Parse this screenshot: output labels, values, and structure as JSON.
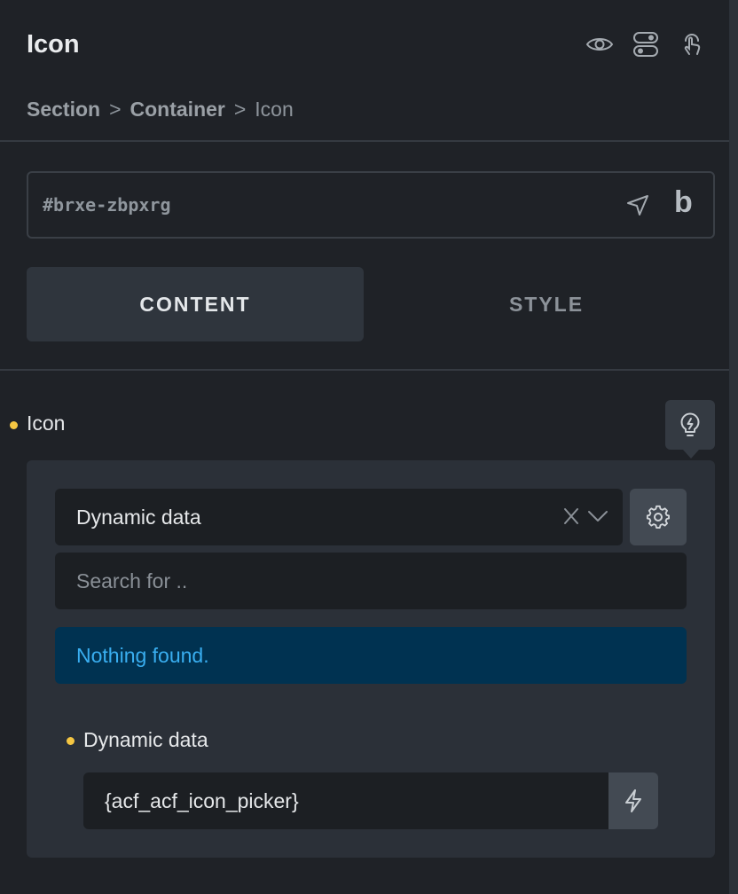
{
  "header": {
    "title": "Icon",
    "icons": [
      "eye-icon",
      "toggle-icon",
      "touch-icon"
    ]
  },
  "breadcrumb": {
    "items": [
      "Section",
      "Container",
      "Icon"
    ],
    "separator": ">"
  },
  "element_id": {
    "value": "#brxe-zbpxrg",
    "brand_letter": "b"
  },
  "tabs": {
    "content": "CONTENT",
    "style": "STYLE"
  },
  "control": {
    "label": "Icon",
    "select_value": "Dynamic data",
    "search_placeholder": "Search for ..",
    "notice": "Nothing found.",
    "dynamic_label": "Dynamic data",
    "dynamic_value": "{acf_acf_icon_picker}"
  },
  "colors": {
    "background": "#1f2227",
    "accent_dot": "#f5c642",
    "notice_bg": "#003251",
    "notice_text": "#39aef0"
  }
}
